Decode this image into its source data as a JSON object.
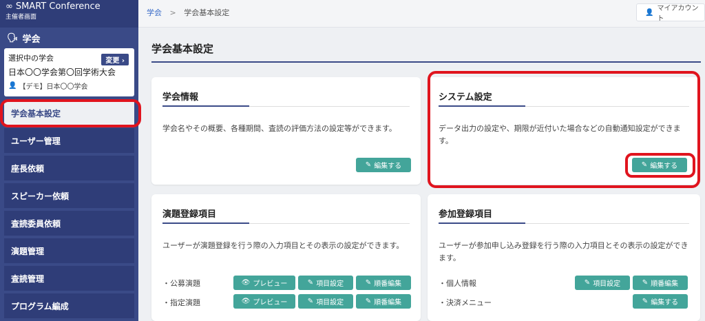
{
  "brand": {
    "title": "SMART Conference",
    "subtitle": "主催者画面"
  },
  "sidebar": {
    "section": "学会",
    "selected_label": "選択中の学会",
    "change_label": "変更",
    "conference_name": "日本〇〇学会第〇回学術大会",
    "organization": "【デモ】日本〇〇学会",
    "items": [
      {
        "label": "学会基本設定"
      },
      {
        "label": "ユーザー管理"
      },
      {
        "label": "座長依頼"
      },
      {
        "label": "スピーカー依頼"
      },
      {
        "label": "査読委員依頼"
      },
      {
        "label": "演題管理"
      },
      {
        "label": "査読管理"
      },
      {
        "label": "プログラム編成"
      }
    ]
  },
  "breadcrumb": {
    "root": "学会",
    "sep": ">",
    "current": "学会基本設定"
  },
  "account": {
    "label": "マイアカウント"
  },
  "page": {
    "title": "学会基本設定"
  },
  "cards": {
    "info": {
      "title": "学会情報",
      "desc": "学会名やその概要、各種期間、査読の評価方法の設定等ができます。",
      "edit": "編集する"
    },
    "system": {
      "title": "システム設定",
      "desc": "データ出力の設定や、期限が近付いた場合などの自動通知設定ができます。",
      "edit": "編集する"
    },
    "abstract": {
      "title": "演題登録項目",
      "desc": "ユーザーが演題登録を行う際の入力項目とその表示の設定ができます。",
      "rows": [
        {
          "label": "・公募演題"
        },
        {
          "label": "・指定演題"
        }
      ],
      "preview": "プレビュー",
      "fields": "項目設定",
      "order": "順番編集"
    },
    "registration": {
      "title": "参加登録項目",
      "desc": "ユーザーが参加申し込み登録を行う際の入力項目とその表示の設定ができます。",
      "rows": [
        {
          "label": "・個人情報"
        },
        {
          "label": "・決済メニュー"
        }
      ],
      "fields": "項目設定",
      "order": "順番編集",
      "edit": "編集する"
    }
  },
  "colors": {
    "sidebar": "#3a4a87",
    "button": "#43a59a",
    "highlight": "#e0141e"
  }
}
